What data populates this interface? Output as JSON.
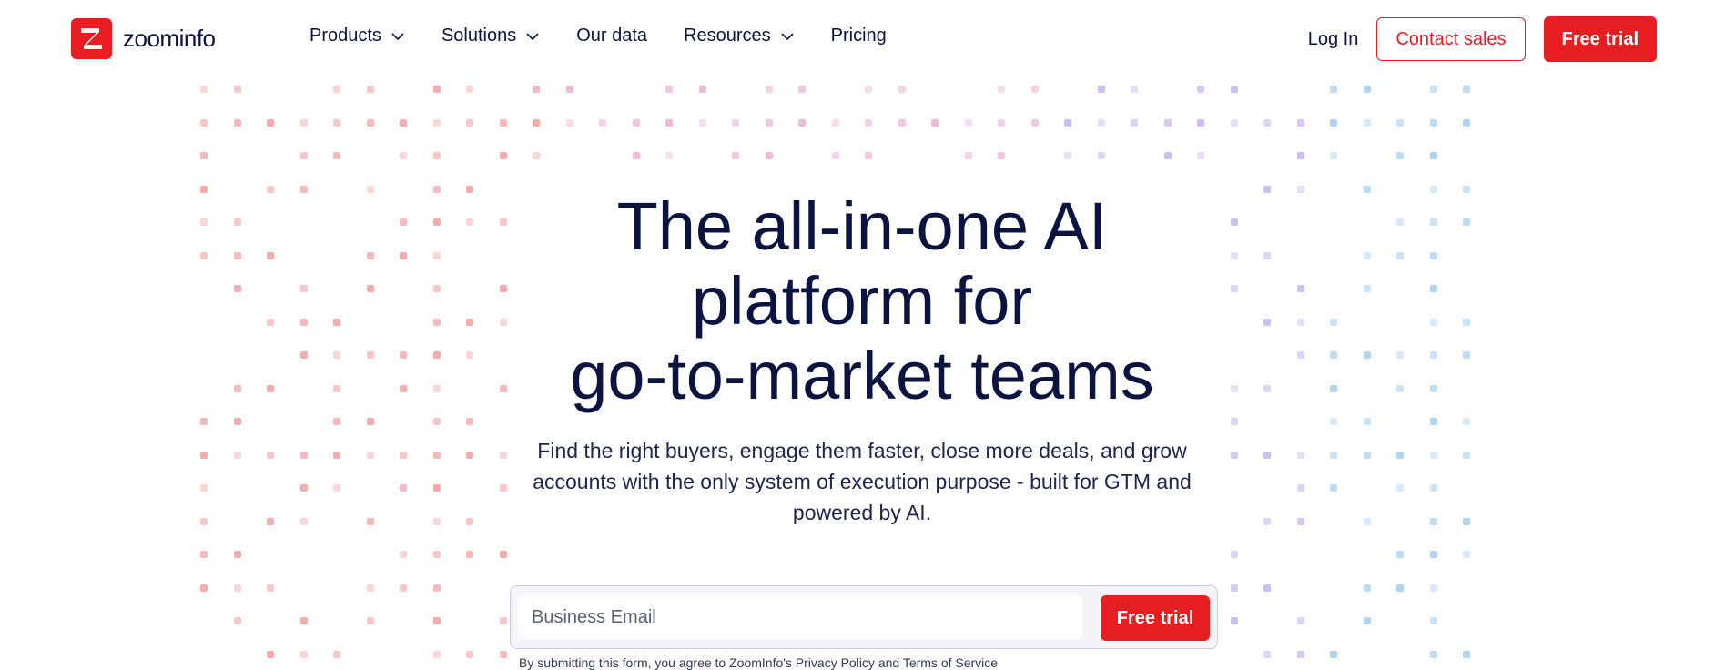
{
  "brand": {
    "name": "zoominfo",
    "accent": "#e61e22",
    "text": "#0b1340"
  },
  "nav": {
    "items": [
      {
        "label": "Products",
        "has_dropdown": true
      },
      {
        "label": "Solutions",
        "has_dropdown": true
      },
      {
        "label": "Our data",
        "has_dropdown": false
      },
      {
        "label": "Resources",
        "has_dropdown": true
      },
      {
        "label": "Pricing",
        "has_dropdown": false
      }
    ],
    "login": "Log In",
    "contact": "Contact sales",
    "trial": "Free trial"
  },
  "hero": {
    "line1": "The all-in-one AI",
    "line2": "platform for",
    "line3": "go-to-market teams",
    "subhead": "Find the right buyers, engage them faster, close more deals, and grow accounts with the only system of execution purpose - built for GTM and powered by AI.",
    "email_placeholder": "Business Email",
    "cta": "Free trial",
    "legal": "By submitting this form, you agree to ZoomInfo's Privacy Policy and Terms of Service"
  },
  "decor": {
    "left_color": "#f08a8a",
    "mid_color": "#e9a0c8",
    "right_color": "#b9a3f0",
    "far_right_color": "#8fc4f0"
  }
}
